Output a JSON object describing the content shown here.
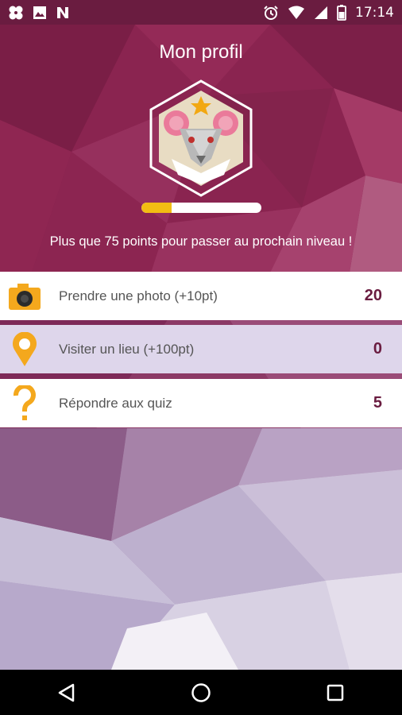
{
  "status_bar": {
    "time": "17:14",
    "left_icons": [
      "pinwheel-icon",
      "image-icon",
      "n-logo-icon"
    ],
    "right_icons": [
      "alarm-icon",
      "wifi-icon",
      "signal-icon",
      "battery-icon"
    ]
  },
  "header": {
    "title": "Mon profil",
    "progress_fraction": 0.25,
    "level_message": "Plus que 75 points pour passer au prochain niveau !"
  },
  "activities": [
    {
      "label": "Prendre une photo (+10pt)",
      "value": "20",
      "icon": "camera-icon"
    },
    {
      "label": "Visiter un lieu (+100pt)",
      "value": "0",
      "icon": "location-pin-icon"
    },
    {
      "label": "Répondre aux quiz",
      "value": "5",
      "icon": "question-mark-icon"
    }
  ],
  "nav_bar": {
    "buttons": [
      "back-icon",
      "home-icon",
      "recents-icon"
    ]
  },
  "colors": {
    "header": "#8a2450",
    "accent_value": "#6a1c40",
    "progress_fill": "#f2bd13",
    "icon_orange": "#f4a81d",
    "row_alt": "#ded6eb"
  }
}
